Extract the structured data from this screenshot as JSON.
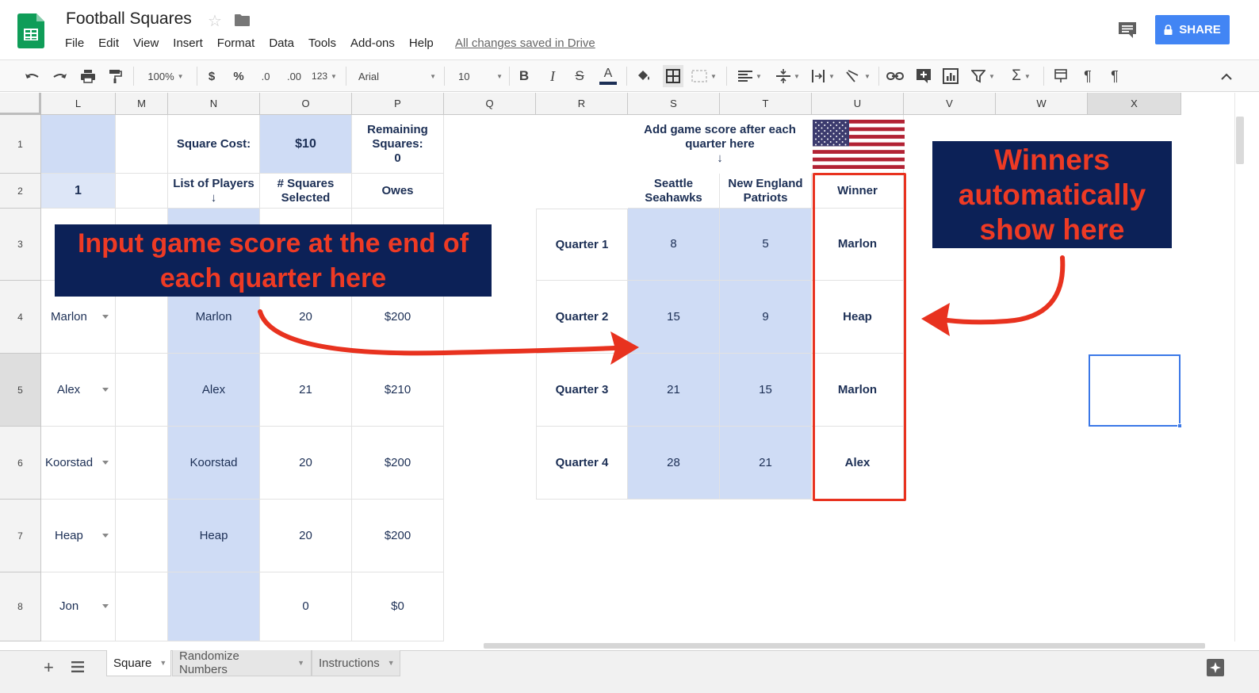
{
  "app": {
    "title": "Football Squares",
    "save_status": "All changes saved in Drive",
    "share_label": "SHARE",
    "brand_color": "#0f9d58",
    "accent_color": "#4285f4"
  },
  "menu": [
    "File",
    "Edit",
    "View",
    "Insert",
    "Format",
    "Data",
    "Tools",
    "Add-ons",
    "Help"
  ],
  "toolbar": {
    "zoom": "100%",
    "currency": "$",
    "percent": "%",
    "decrease_decimals": ".0",
    "increase_decimals": ".00",
    "more_formats": "123",
    "font": "Arial",
    "font_size": "10"
  },
  "columns": [
    "L",
    "M",
    "N",
    "O",
    "P",
    "Q",
    "R",
    "S",
    "T",
    "U",
    "V",
    "W",
    "X"
  ],
  "rows": [
    "1",
    "2",
    "3",
    "4",
    "5",
    "6",
    "7",
    "8"
  ],
  "cells": {
    "square_cost_label": "Square Cost:",
    "square_cost_value": "$10",
    "remaining_label": "Remaining Squares:",
    "remaining_value": "0",
    "l2_value": "1",
    "players_header": "List of Players",
    "players_arrow": "↓",
    "squares_header": "# Squares Selected",
    "owes_header": "Owes",
    "score_hint": "Add game score after each quarter here",
    "score_hint_arrow": "↓",
    "team1": "Seattle Seahawks",
    "team2": "New England Patriots",
    "winner_header": "Winner"
  },
  "dropdown_players": [
    "Marlon",
    "Alex",
    "Koorstad",
    "Heap",
    "Jon"
  ],
  "players_table": [
    {
      "name": "Marlon",
      "squares": "20",
      "owes": "$200"
    },
    {
      "name": "Alex",
      "squares": "21",
      "owes": "$210"
    },
    {
      "name": "Koorstad",
      "squares": "20",
      "owes": "$200"
    },
    {
      "name": "Heap",
      "squares": "20",
      "owes": "$200"
    },
    {
      "name": "",
      "squares": "0",
      "owes": "$0"
    }
  ],
  "quarters": [
    {
      "label": "Quarter 1",
      "team1": "8",
      "team2": "5",
      "winner": "Marlon"
    },
    {
      "label": "Quarter 2",
      "team1": "15",
      "team2": "9",
      "winner": "Heap"
    },
    {
      "label": "Quarter 3",
      "team1": "21",
      "team2": "15",
      "winner": "Marlon"
    },
    {
      "label": "Quarter 4",
      "team1": "28",
      "team2": "21",
      "winner": "Alex"
    }
  ],
  "annotations": {
    "left_callout": "Input game score at the end of each quarter here",
    "right_callout": "Winners automatically show here",
    "callout_bg": "#0c2157",
    "callout_text_color": "#ee3a24",
    "arrow_color": "#e8321f"
  },
  "sheet_tabs": [
    "Square",
    "Randomize Numbers",
    "Instructions"
  ]
}
